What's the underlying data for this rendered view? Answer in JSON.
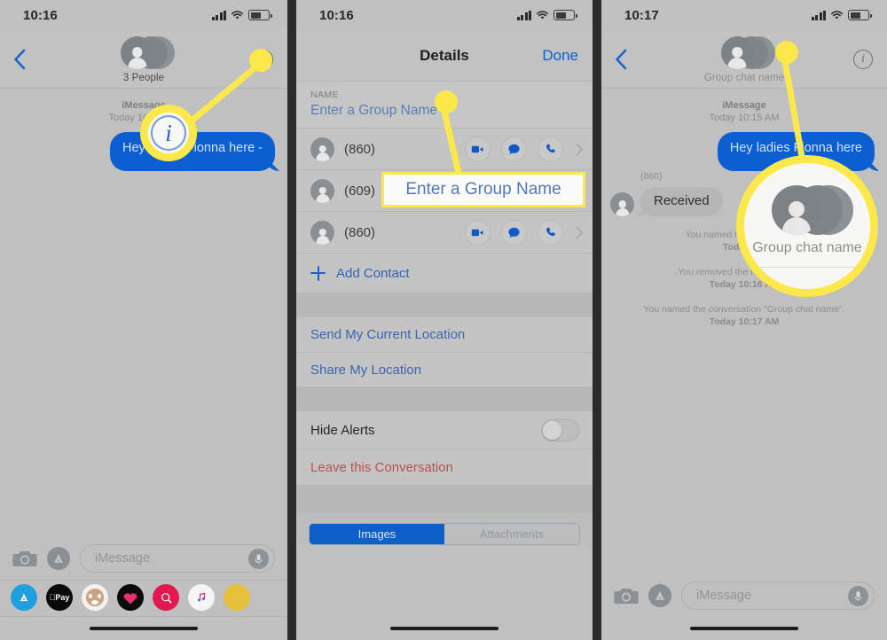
{
  "panels": {
    "left": {
      "status": {
        "time": "10:16"
      },
      "header": {
        "group_name": "3 People",
        "back_icon": "back-chevron-icon",
        "info_icon": "info-circle-icon"
      },
      "message_meta": {
        "service": "iMessage",
        "timestamp": "Today 10:15 AM"
      },
      "sent_message": "Hey ladies Fionna here -",
      "input": {
        "placeholder": "iMessage"
      },
      "apps": [
        "app-store",
        "apple-pay",
        "memoji",
        "digital-touch",
        "images",
        "music",
        "more"
      ]
    },
    "middle": {
      "status": {
        "time": "10:16"
      },
      "header": {
        "title": "Details",
        "done_label": "Done"
      },
      "name_section": {
        "caption": "NAME",
        "value": "Enter a Group Name"
      },
      "contacts": [
        {
          "name": "(860)",
          "show_actions": true
        },
        {
          "name": "(609)",
          "show_actions": false
        },
        {
          "name": "(860)",
          "show_actions": true
        }
      ],
      "add_contact_label": "Add Contact",
      "links": [
        "Send My Current Location",
        "Share My Location"
      ],
      "hide_alerts_label": "Hide Alerts",
      "leave_label": "Leave this Conversation",
      "segmented": {
        "selected": "Images",
        "other": "Attachments"
      }
    },
    "right": {
      "status": {
        "time": "10:17"
      },
      "header": {
        "group_name": "Group chat name",
        "back_icon": "back-chevron-icon",
        "info_icon": "info-circle-icon"
      },
      "message_meta": {
        "service": "iMessage",
        "timestamp": "Today 10:15 AM"
      },
      "sent_message": "Hey ladies Fionna here",
      "received": {
        "sender": "(860)",
        "text": "Received"
      },
      "system_notes": [
        {
          "text": "You named the conversation",
          "time": "Today 10:"
        },
        {
          "text": "You removed the name from the",
          "time": "Today 10:16 AM"
        },
        {
          "text": "You named the conversation \"Group chat name\".",
          "time": "Today 10:17 AM"
        }
      ],
      "input": {
        "placeholder": "iMessage"
      }
    }
  },
  "highlights": {
    "color": "#fbe94b",
    "left_callout": {
      "icon": "info-circle-icon"
    },
    "middle_callout": {
      "text": "Enter a Group Name"
    },
    "right_callout": {
      "text": "Group chat name"
    }
  }
}
